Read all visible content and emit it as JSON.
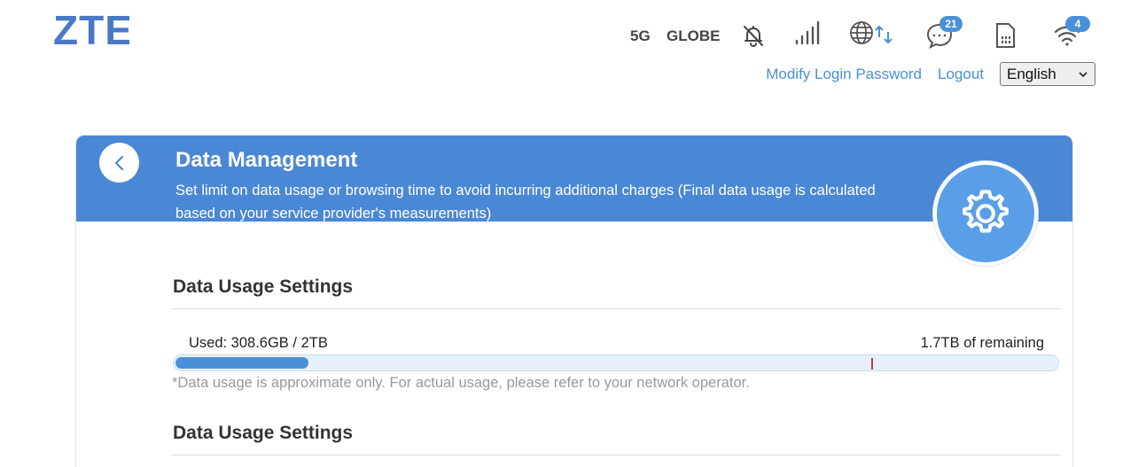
{
  "brand": {
    "logo_text": "ZTE",
    "logo_color": "#4a78c8"
  },
  "status": {
    "network_type": "5G",
    "operator": "GLOBE",
    "icons": [
      "bell-muted-icon",
      "signal-strength-icon",
      "globe-data-icon",
      "messages-icon",
      "sim-card-icon",
      "wifi-icon"
    ],
    "messages_count": "21",
    "wifi_clients_count": "4"
  },
  "top_links": {
    "modify_password": "Modify Login Password",
    "logout": "Logout",
    "language": "English"
  },
  "header": {
    "title": "Data Management",
    "description": "Set limit on data usage or browsing time to avoid incurring additional charges (Final data usage is calculated based on your service provider's measurements)",
    "color": "#4a88d6"
  },
  "usage": {
    "section_title": "Data Usage Settings",
    "used_label": "Used: 308.6GB / 2TB",
    "remaining_label": "1.7TB of remaining",
    "used_fraction": 0.151,
    "marker_fraction": 0.79,
    "note": "*Data usage is approximate only. For actual usage, please refer to your network operator.",
    "bar_color": "#4a90d9"
  },
  "second_section": {
    "title": "Data Usage Settings"
  }
}
